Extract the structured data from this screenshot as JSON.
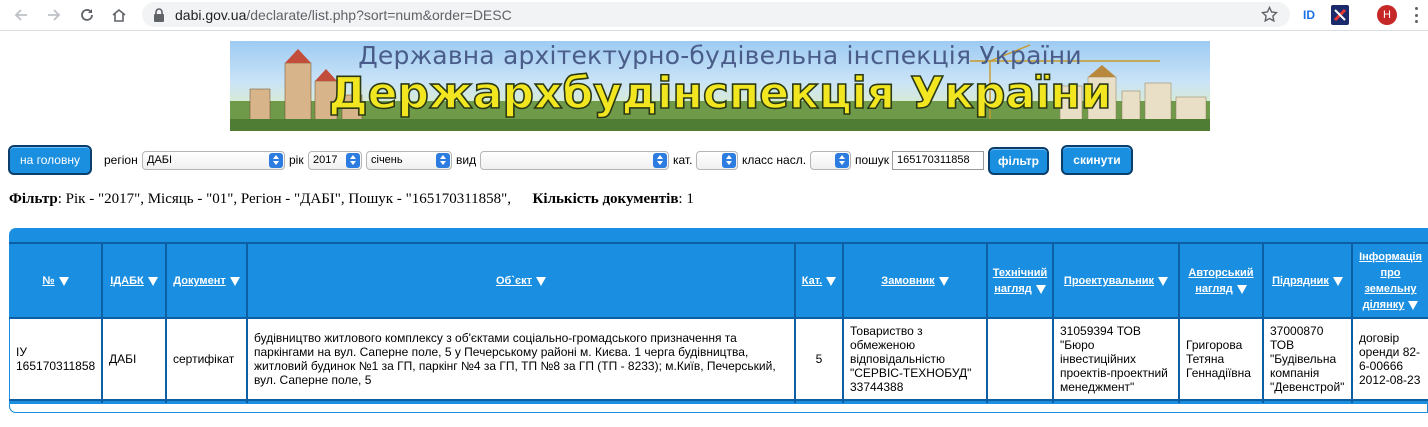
{
  "browser": {
    "url_host": "dabi.gov.ua",
    "url_path": "/declarate/list.php?sort=num&order=DESC",
    "ext_label": "ID",
    "profile_initial": "H"
  },
  "banner": {
    "subtitle": "Державна архітектурно-будівельна інспекція України",
    "title": "Держархбудінспекція України"
  },
  "filters": {
    "home_button": "на головну",
    "region_label": "регіон",
    "region_value": "ДАБІ",
    "year_label": "рік",
    "year_value": "2017",
    "month_value": "січень",
    "type_label": "вид",
    "type_value": "",
    "cat_label": "кат.",
    "cat_value": "",
    "class_label": "класс насл.",
    "class_value": "",
    "search_label": "пошук",
    "search_value": "165170311858",
    "filter_button": "фільтр",
    "reset_button": "скинути"
  },
  "summary": {
    "filter_label": "Фільтр",
    "filter_text": ": Рік - \"2017\", Місяць - \"01\", Регіон - \"ДАБІ\", Пошук - \"165170311858\",",
    "count_label": "Кількість документів",
    "count_value": ": 1"
  },
  "table": {
    "headers": [
      {
        "lines": [
          "№"
        ]
      },
      {
        "lines": [
          "ІДАБК"
        ]
      },
      {
        "lines": [
          "Документ"
        ]
      },
      {
        "lines": [
          "Об`єкт"
        ]
      },
      {
        "lines": [
          "Кат."
        ]
      },
      {
        "lines": [
          "Замовник"
        ]
      },
      {
        "lines": [
          "Технічний",
          "нагляд"
        ]
      },
      {
        "lines": [
          "Проектувальник"
        ]
      },
      {
        "lines": [
          "Авторський",
          "нагляд"
        ]
      },
      {
        "lines": [
          "Підрядник"
        ]
      },
      {
        "lines": [
          "Інформація",
          "про",
          "земельну",
          "ділянку"
        ]
      }
    ],
    "rows": [
      {
        "num": "ІУ 165170311858",
        "idabk": "ДАБІ",
        "document": "сертифікат",
        "object": "будівництво житлового комплексу з об'єктами соціально-громадського призначення та паркінгами на вул. Саперне поле, 5 у Печерському районі м. Києва. 1 черга будівництва, житловий будинок №1 за ГП, паркінг №4 за ГП, ТП №8 за ГП (ТП - 8233); м.Київ, Печерський, вул. Саперне поле, 5",
        "category": "5",
        "customer": "Товариство з обмеженою відповідальністю \"СЕРВІС-ТЕХНОБУД\" 33744388",
        "tech_supervision": "",
        "designer": "31059394 ТОВ \"Бюро інвестиційних проектів-проектний менеджмент\"",
        "author_supervision": "Григорова Тетяна Геннадіївна",
        "contractor": "37000870 ТОВ \"Будівельна компанія \"Девенстрой\"",
        "land_info": "договір оренди 82-6-00666 2012-08-23"
      }
    ]
  }
}
